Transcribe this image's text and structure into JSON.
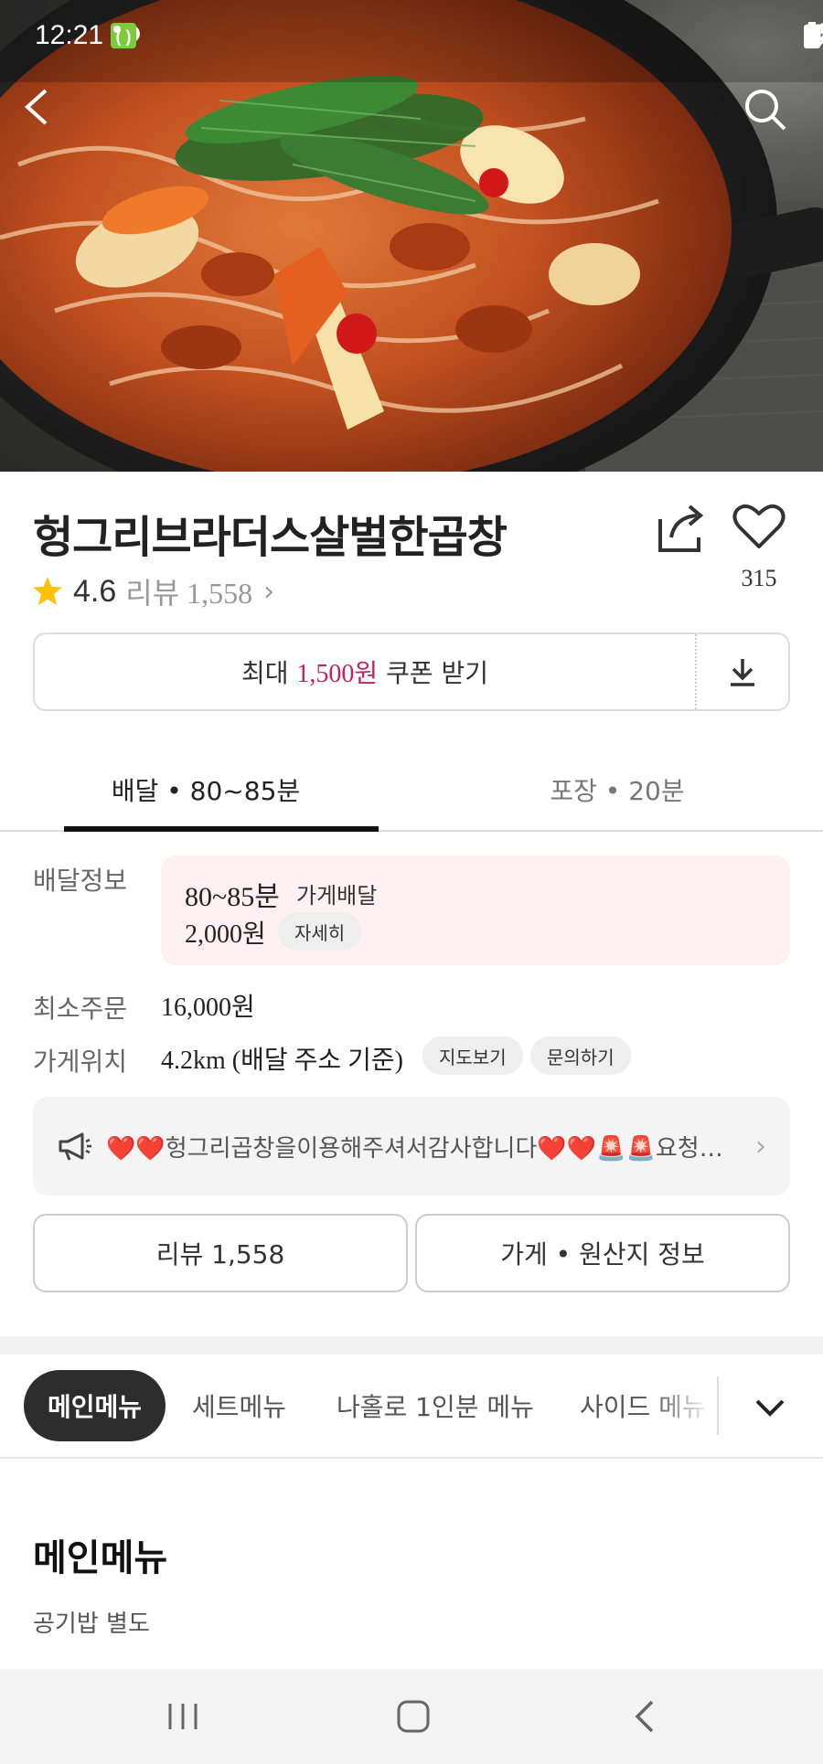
{
  "status_bar": {
    "time": "12:21",
    "left_icons": [
      "talk-icon",
      "chat-bubble-icon",
      "app-icon",
      "dot-icon"
    ],
    "right_icons": [
      "alarm-icon",
      "mute-icon",
      "wifi-icon",
      "signal-icon",
      "battery-icon"
    ]
  },
  "hero": {
    "image": "food-photo-spicy-gopchang-pan",
    "back_icon": "back-arrow-icon",
    "search_icon": "search-icon"
  },
  "store": {
    "name": "헝그리브라더스살벌한곱창",
    "rating": "4.6",
    "review_label": "리뷰 1,558",
    "like_count": "315"
  },
  "coupon": {
    "prefix": "최대 ",
    "amount": "1,500원",
    "suffix": " 쿠폰 받기",
    "download_icon": "download-icon"
  },
  "tabs": [
    {
      "label": "배달 • 80~85분",
      "active": true
    },
    {
      "label": "포장 • 20분",
      "active": false
    }
  ],
  "delivery_info": {
    "label": "배달정보",
    "time": "80~85분",
    "type": "가게배달",
    "fee": "2,000원",
    "detail_button": "자세히"
  },
  "min_order": {
    "label": "최소주문",
    "value": "16,000원"
  },
  "location": {
    "label": "가게위치",
    "value": "4.2km (배달 주소 기준)",
    "map_button": "지도보기",
    "inquiry_button": "문의하기"
  },
  "notice": {
    "icon": "megaphone-icon",
    "text": "❤️❤️헝그리곱창을이용해주셔서감사합니다❤️❤️🚨🚨요청…"
  },
  "buttons": {
    "reviews": "리뷰 1,558",
    "store_info": "가게 • 원산지 정보"
  },
  "menu_tabs": [
    "메인메뉴",
    "세트메뉴",
    "나홀로 1인분 메뉴",
    "사이드 메뉴"
  ],
  "menu_section": {
    "title": "메인메뉴",
    "subtitle": "공기밥 별도"
  },
  "colors": {
    "accent": "#c7215d",
    "delivery_box_bg": "#fff0f3",
    "active_tab_bg": "#2d2d2d"
  },
  "nav_bar": {
    "recent": "recent-apps-icon",
    "home": "home-icon",
    "back": "back-icon"
  }
}
